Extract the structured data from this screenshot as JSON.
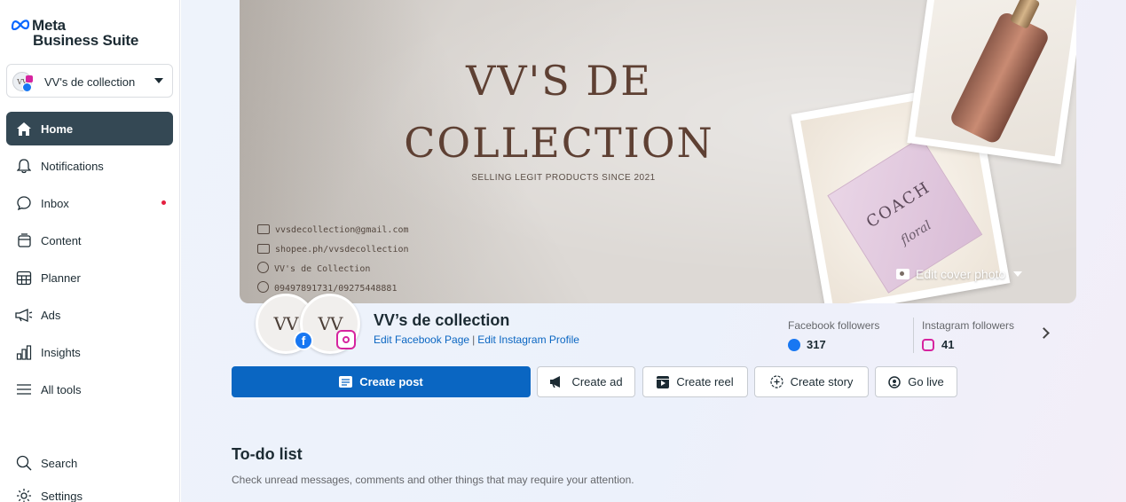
{
  "app": {
    "logo_line1": "Meta",
    "logo_line2": "Business Suite"
  },
  "account": {
    "name": "VV's de collection",
    "avatar_text": "VV"
  },
  "sidebar": {
    "items": [
      {
        "label": "Home",
        "icon": "home-icon",
        "active": true
      },
      {
        "label": "Notifications",
        "icon": "bell-icon"
      },
      {
        "label": "Inbox",
        "icon": "chat-bubble-icon",
        "badge": "unread-dot"
      },
      {
        "label": "Content",
        "icon": "content-icon"
      },
      {
        "label": "Planner",
        "icon": "calendar-grid-icon"
      },
      {
        "label": "Ads",
        "icon": "megaphone-icon"
      },
      {
        "label": "Insights",
        "icon": "bar-chart-icon"
      },
      {
        "label": "All tools",
        "icon": "hamburger-menu-icon"
      },
      {
        "label": "Search",
        "icon": "search-icon"
      },
      {
        "label": "Settings",
        "icon": "gear-icon"
      }
    ]
  },
  "cover": {
    "title_line1": "VV'S DE",
    "title_line2": "COLLECTION",
    "tagline": "SELLING LEGIT PRODUCTS SINCE 2021",
    "contacts": [
      {
        "icon": "mail-icon",
        "text": "vvsdecollection@gmail.com"
      },
      {
        "icon": "cart-icon",
        "text": "shopee.ph/vvsdecollection"
      },
      {
        "icon": "facebook-icon",
        "text": "VV's de Collection"
      },
      {
        "icon": "phone-icon",
        "text": "09497891731/09275448881"
      }
    ],
    "product_box_brand": "COACH",
    "product_box_name": "floral",
    "edit_label": "Edit cover photo"
  },
  "profile": {
    "name": "VV’s de collection",
    "edit_fb": "Edit Facebook Page",
    "edit_ig": "Edit Instagram Profile",
    "separator": "|",
    "logo_text": "VV"
  },
  "stats": {
    "facebook_label": "Facebook followers",
    "facebook_value": "317",
    "instagram_label": "Instagram followers",
    "instagram_value": "41"
  },
  "actions": {
    "create_post": "Create post",
    "create_ad": "Create ad",
    "create_reel": "Create reel",
    "create_story": "Create story",
    "go_live": "Go live"
  },
  "todo": {
    "title": "To-do list",
    "subtitle": "Check unread messages, comments and other things that may require your attention."
  },
  "colors": {
    "primary": "#0a66c2",
    "sidebar_active": "#344854",
    "facebook": "#1877f2",
    "instagram": "#d6249f",
    "notification_dot": "#e41e3f"
  }
}
